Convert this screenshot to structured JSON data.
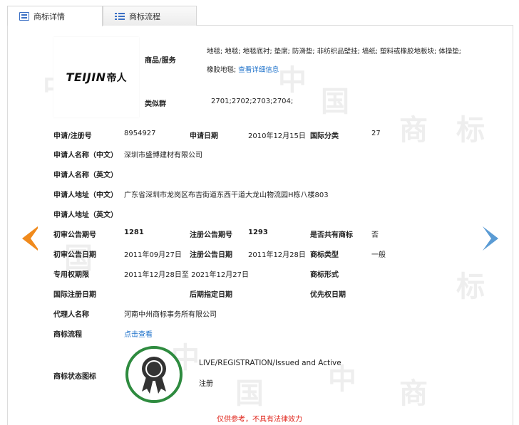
{
  "tabs": [
    {
      "label": "商标详情",
      "icon": "document-icon",
      "active": true
    },
    {
      "label": "商标流程",
      "icon": "list-icon",
      "active": false
    }
  ],
  "watermark": "中国商标",
  "logo": {
    "text_en": "TEIJIN",
    "text_cn": "帝人"
  },
  "goods_label": "商品/服务",
  "goods_text": "地毯; 地毯; 地毯底衬; 垫席; 防滑垫; 非纺织品壁挂; 墙纸; 塑料或橡胶地板块; 体操垫; 橡胶地毯;",
  "goods_more": "查看详细信息",
  "class_group_label": "类似群",
  "class_group_value": "2701;2702;2703;2704;",
  "fields": {
    "reg_no_label": "申请/注册号",
    "reg_no": "8954927",
    "apply_date_label": "申请日期",
    "apply_date": "2010年12月15日",
    "intl_class_label": "国际分类",
    "intl_class": "27",
    "applicant_cn_label": "申请人名称（中文）",
    "applicant_cn": "深圳市盛博建材有限公司",
    "applicant_en_label": "申请人名称（英文）",
    "address_cn_label": "申请人地址（中文）",
    "address_cn": "广东省深圳市龙岗区布吉街道东西干道大龙山物流园H栋八楼803",
    "address_en_label": "申请人地址（英文）",
    "prelim_no_label": "初审公告期号",
    "prelim_no": "1281",
    "reg_pub_no_label": "注册公告期号",
    "reg_pub_no": "1293",
    "shared_label": "是否共有商标",
    "shared": "否",
    "prelim_date_label": "初审公告日期",
    "prelim_date": "2011年09月27日",
    "reg_pub_date_label": "注册公告日期",
    "reg_pub_date": "2011年12月28日",
    "tm_type_label": "商标类型",
    "tm_type": "一般",
    "exclusive_label": "专用权期限",
    "exclusive": "2011年12月28日至 2021年12月27日",
    "tm_form_label": "商标形式",
    "intl_reg_date_label": "国际注册日期",
    "later_date_label": "后期指定日期",
    "priority_date_label": "优先权日期",
    "agent_label": "代理人名称",
    "agent": "河南中州商标事务所有限公司",
    "process_label": "商标流程",
    "process_link": "点击查看",
    "status_icon_label": "商标状态图标",
    "status_en": "LIVE/REGISTRATION/Issued and Active",
    "status_cn": "注册"
  },
  "disclaimer": "仅供参考，不具有法律效力",
  "colors": {
    "accent": "#1a6fc9",
    "prev_arrow": "#f08a1c",
    "next_arrow": "#5a9bd4",
    "badge_ring": "#2e8b3f",
    "disclaimer": "#e0261c"
  }
}
